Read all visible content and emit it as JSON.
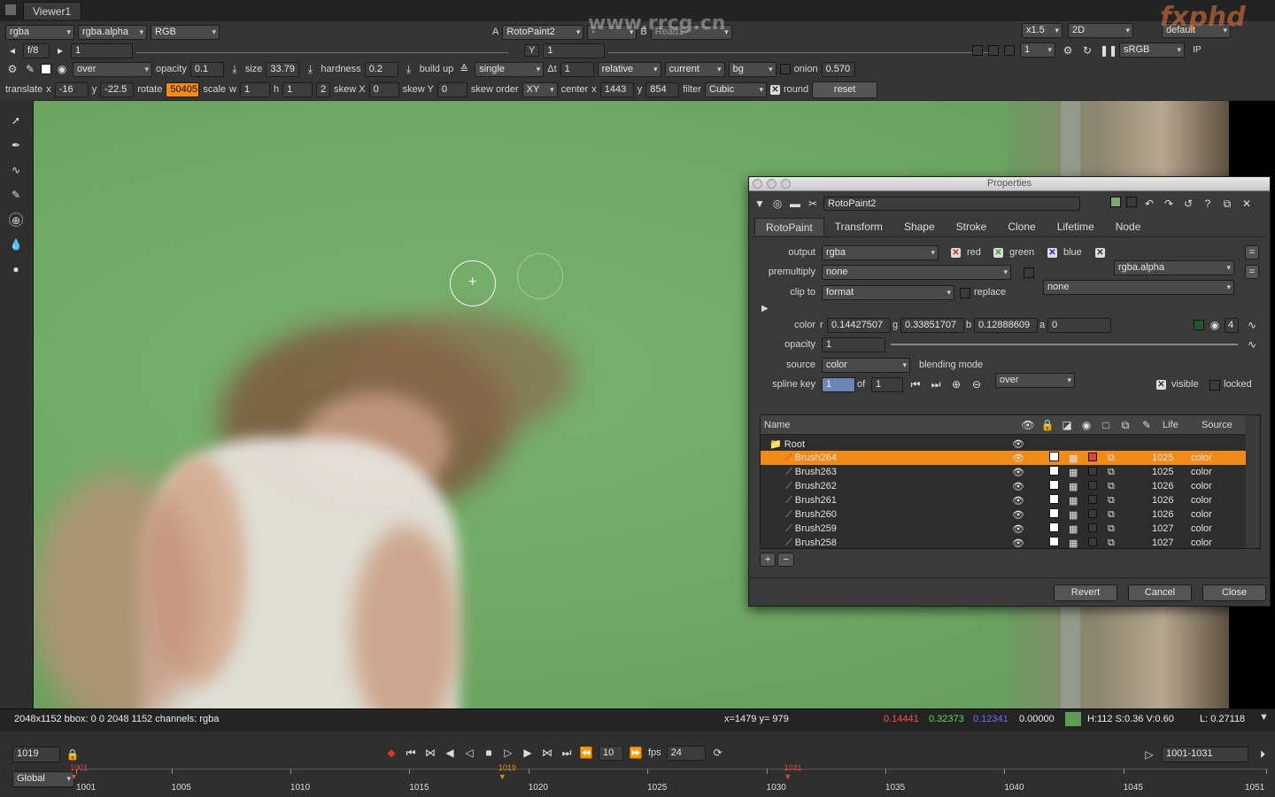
{
  "viewer_tab": "Viewer1",
  "toolbar1": {
    "channels": "rgba",
    "alpha_channel": "rgba.alpha",
    "colorspace": "RGB",
    "input_a_label": "A",
    "input_a": "RotoPaint2",
    "input_a_op": "-",
    "input_b_label": "B",
    "input_b": "Read1",
    "zoom": "x1.5",
    "view_mode": "2D",
    "lut": "default"
  },
  "toolbar2": {
    "fstop": "f/8",
    "frame_field": "1",
    "y_label": "Y",
    "y_value": "1",
    "proxy": "1",
    "display": "sRGB"
  },
  "toolbar3": {
    "blend": "over",
    "opacity_label": "opacity",
    "opacity": "0.1",
    "size_label": "size",
    "size": "33.79",
    "hardness_label": "hardness",
    "hardness": "0.2",
    "buildup_label": "build up",
    "mode": "single",
    "dt_label": "Δt",
    "dt": "1",
    "relative": "relative",
    "current": "current",
    "bg": "bg",
    "onion_label": "onion",
    "onion": "0.570"
  },
  "toolbar4": {
    "translate_label": "translate",
    "tx_label": "x",
    "tx": "-16",
    "ty_label": "y",
    "ty": "-22.5",
    "rotate_label": "rotate",
    "rotate": "50405",
    "scale_label": "scale",
    "sw_label": "w",
    "sw": "1",
    "sh_label": "h",
    "sh": "1",
    "num2": "2",
    "skewx_label": "skew X",
    "skewx": "0",
    "skewy_label": "skew Y",
    "skewy": "0",
    "skeworder_label": "skew order",
    "skeworder": "XY",
    "center_label": "center",
    "cx_label": "x",
    "cx": "1443",
    "cy_label": "y",
    "cy": "854",
    "filter_label": "filter",
    "filter": "Cubic",
    "round_label": "round",
    "reset": "reset"
  },
  "watermark_site": "www.rrcg.cn",
  "logo": "fxphd",
  "props": {
    "title": "Properties",
    "node_name": "RotoPaint2",
    "tabs": [
      "RotoPaint",
      "Transform",
      "Shape",
      "Stroke",
      "Clone",
      "Lifetime",
      "Node"
    ],
    "output_label": "output",
    "output": "rgba",
    "red": "red",
    "green": "green",
    "blue": "blue",
    "output_alpha": "rgba.alpha",
    "premult_label": "premultiply",
    "premult": "none",
    "premult2": "none",
    "clip_label": "clip to",
    "clip": "format",
    "replace": "replace",
    "color_label": "color",
    "r_label": "r",
    "r": "0.14427507",
    "g_label": "g",
    "g": "0.33851707",
    "b_label": "b",
    "b": "0.12888609",
    "a_label": "a",
    "a": "0",
    "color_count": "4",
    "opacity_label": "opacity",
    "opacity": "1",
    "source_label": "source",
    "source": "color",
    "blend_label": "blending mode",
    "blend": "over",
    "splinekey_label": "spline key",
    "splinekey": "1",
    "of_label": "of",
    "of": "1",
    "visible": "visible",
    "locked": "locked",
    "table": {
      "col_name": "Name",
      "col_life": "Life",
      "col_source": "Source",
      "root": "Root",
      "rows": [
        {
          "name": "Brush264",
          "life": "1025",
          "source": "color",
          "selected": true
        },
        {
          "name": "Brush263",
          "life": "1025",
          "source": "color"
        },
        {
          "name": "Brush262",
          "life": "1026",
          "source": "color"
        },
        {
          "name": "Brush261",
          "life": "1026",
          "source": "color"
        },
        {
          "name": "Brush260",
          "life": "1026",
          "source": "color"
        },
        {
          "name": "Brush259",
          "life": "1027",
          "source": "color"
        },
        {
          "name": "Brush258",
          "life": "1027",
          "source": "color"
        }
      ]
    },
    "add": "+",
    "remove": "−",
    "revert": "Revert",
    "cancel": "Cancel",
    "close": "Close"
  },
  "status": {
    "info": "2048x1152 bbox: 0 0 2048 1152 channels: rgba",
    "coords": "x=1479 y= 979",
    "r": "0.14441",
    "g": "0.32373",
    "b": "0.12341",
    "a": "0.00000",
    "hsv": "H:112 S:0.36 V:0.60",
    "l": "L: 0.27118"
  },
  "transport": {
    "frame": "1019",
    "step": "10",
    "fps_label": "fps",
    "fps": "24",
    "range": "1001-1031",
    "scope": "Global"
  },
  "timeline": {
    "start": 1001,
    "end": 1051,
    "current": 1019,
    "in": 1001,
    "out": 1031,
    "ticks": [
      "1001",
      "1005",
      "1010",
      "1015",
      "1020",
      "1025",
      "1030",
      "1035",
      "1040",
      "1045",
      "1051"
    ],
    "marker_start": "1001",
    "marker_current": "1019",
    "marker_end": "1031"
  }
}
